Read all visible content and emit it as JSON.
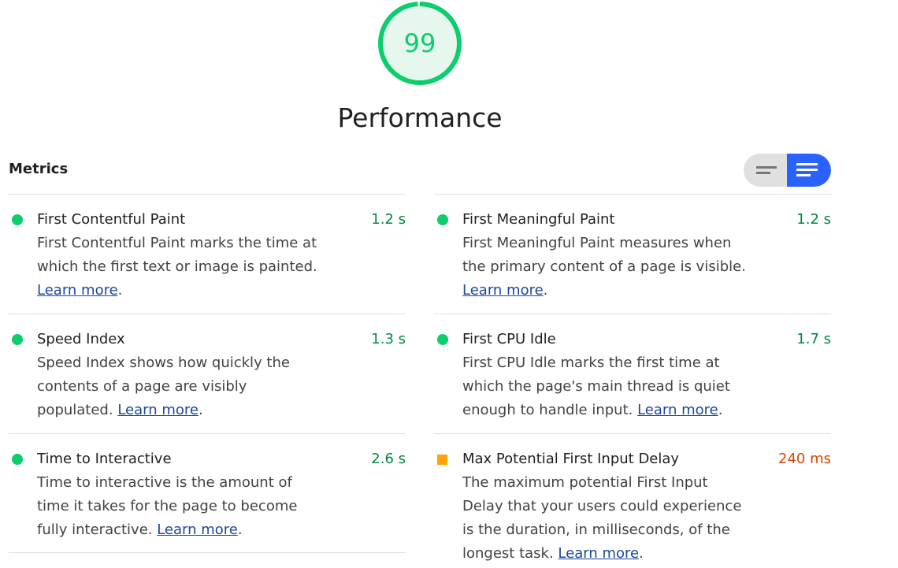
{
  "category": {
    "score": "99",
    "score_fraction": 0.99,
    "title": "Performance",
    "score_color": "#0cce6b"
  },
  "metrics": {
    "heading": "Metrics",
    "view_toggle": {
      "compact_icon": "compact-list-icon",
      "expanded_icon": "expanded-list-icon",
      "active": "expanded",
      "active_color": "#2962ff"
    },
    "link_label": "Learn more",
    "items": [
      {
        "title": "First Contentful Paint",
        "value": "1.2 s",
        "status": "pass",
        "description": "First Contentful Paint marks the time at which the first text or image is painted. "
      },
      {
        "title": "First Meaningful Paint",
        "value": "1.2 s",
        "status": "pass",
        "description": "First Meaningful Paint measures when the primary content of a page is visible. "
      },
      {
        "title": "Speed Index",
        "value": "1.3 s",
        "status": "pass",
        "description": "Speed Index shows how quickly the contents of a page are visibly populated. "
      },
      {
        "title": "First CPU Idle",
        "value": "1.7 s",
        "status": "pass",
        "description": "First CPU Idle marks the first time at which the page's main thread is quiet enough to handle input. "
      },
      {
        "title": "Time to Interactive",
        "value": "2.6 s",
        "status": "pass",
        "description": "Time to interactive is the amount of time it takes for the page to become fully interactive. "
      },
      {
        "title": "Max Potential First Input Delay",
        "value": "240 ms",
        "status": "average",
        "description": "The maximum potential First Input Delay that your users could experience is the duration, in milliseconds, of the longest task. "
      }
    ]
  },
  "colors": {
    "pass": "#0cce6b",
    "pass_text": "#018642",
    "average": "#ffa400",
    "average_text": "#d04900",
    "link": "#1a47a0"
  }
}
